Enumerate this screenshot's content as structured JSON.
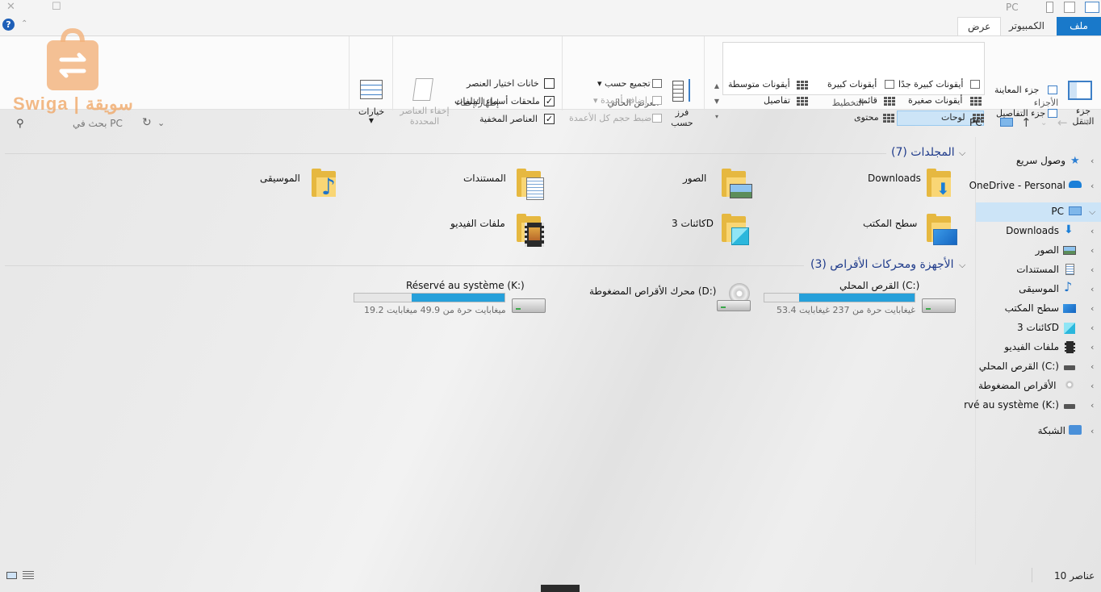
{
  "window": {
    "title": "PC",
    "minimize": "—",
    "maximize": "☐",
    "close": "✕"
  },
  "ribbon_tabs": {
    "file": "ملف",
    "computer": "الكمبيوتر",
    "view": "عرض",
    "help": "?"
  },
  "ribbon": {
    "panes": {
      "nav_pane_line1": "جزء",
      "nav_pane_line2": "التنقل",
      "preview_pane": "جزء المعاينة",
      "details_pane": "جزء التفاصيل",
      "group_label": "الأجزاء"
    },
    "layout": {
      "extra_large_icons": "أيقونات كبيرة جدًا",
      "large_icons": "أيقونات كبيرة",
      "medium_icons": "أيقونات متوسطة",
      "small_icons": "أيقونات صغيرة",
      "list": "قائمة",
      "details": "تفاصيل",
      "tiles": "لوحات",
      "content": "محتوى",
      "group_label": "التخطيط"
    },
    "current_view": {
      "sort_by_line1": "فرز",
      "sort_by_line2": "حسب",
      "group_by": "تجميع حسب",
      "add_columns": "إضافة أعمدة",
      "size_columns": "ضبط حجم كل الأعمدة",
      "group_label": "العرض الحالي"
    },
    "show_hide": {
      "item_check_boxes": "خانات اختيار العنصر",
      "file_name_extensions": "ملحقات أسماء الملفات",
      "hidden_items": "العناصر المخفية",
      "hide_selected_line1": "إخفاء العناصر",
      "hide_selected_line2": "المحددة",
      "group_label": "إظهار/إخفاء"
    },
    "options": {
      "label": "خيارات"
    }
  },
  "address": {
    "path": "PC",
    "search_placeholder": "بحث في PC"
  },
  "folders_section": {
    "title": "المجلدات (7)",
    "items": [
      {
        "label": "Downloads"
      },
      {
        "label": "الصور"
      },
      {
        "label": "المستندات"
      },
      {
        "label": "الموسيقى"
      },
      {
        "label": "سطح المكتب"
      },
      {
        "label": "كائنات 3D"
      },
      {
        "label": "ملفات الفيديو"
      }
    ]
  },
  "devices_section": {
    "title": "الأجهزة ومحركات الأقراص (3)",
    "drives": [
      {
        "label": "القرص المحلي (C:)",
        "sub": "53.4 غيغابايت حرة من 237 غيغابايت",
        "used_fraction": 0.77
      },
      {
        "label": "محرك الأقراص المضغوطة (D:)"
      },
      {
        "label": "Réservé au système (K:)",
        "sub": "19.2 ميغابايت حرة من 49.9 ميغابايت",
        "used_fraction": 0.62
      }
    ]
  },
  "nav_pane": {
    "quick_access": "وصول سريع",
    "onedrive": "OneDrive - Personal",
    "this_pc": "PC",
    "downloads": "Downloads",
    "pictures": "الصور",
    "documents": "المستندات",
    "music": "الموسيقى",
    "desktop": "سطح المكتب",
    "objects3d": "كائنات 3D",
    "videos": "ملفات الفيديو",
    "local_disk": "القرص المحلي (C:)",
    "cd_drive": "محرك الأقراص المضغوطة",
    "reserved": "rvé au système (K:)",
    "network": "الشبكة"
  },
  "status": {
    "count": "10 عناصر"
  },
  "watermark": {
    "text": "Swiga | سويقة"
  },
  "colors": {
    "accent": "#1979ca",
    "selection": "#cce4f7",
    "drive_fill": "#26a0da",
    "folder": "#e6b840",
    "watermark": "#f0a460"
  }
}
